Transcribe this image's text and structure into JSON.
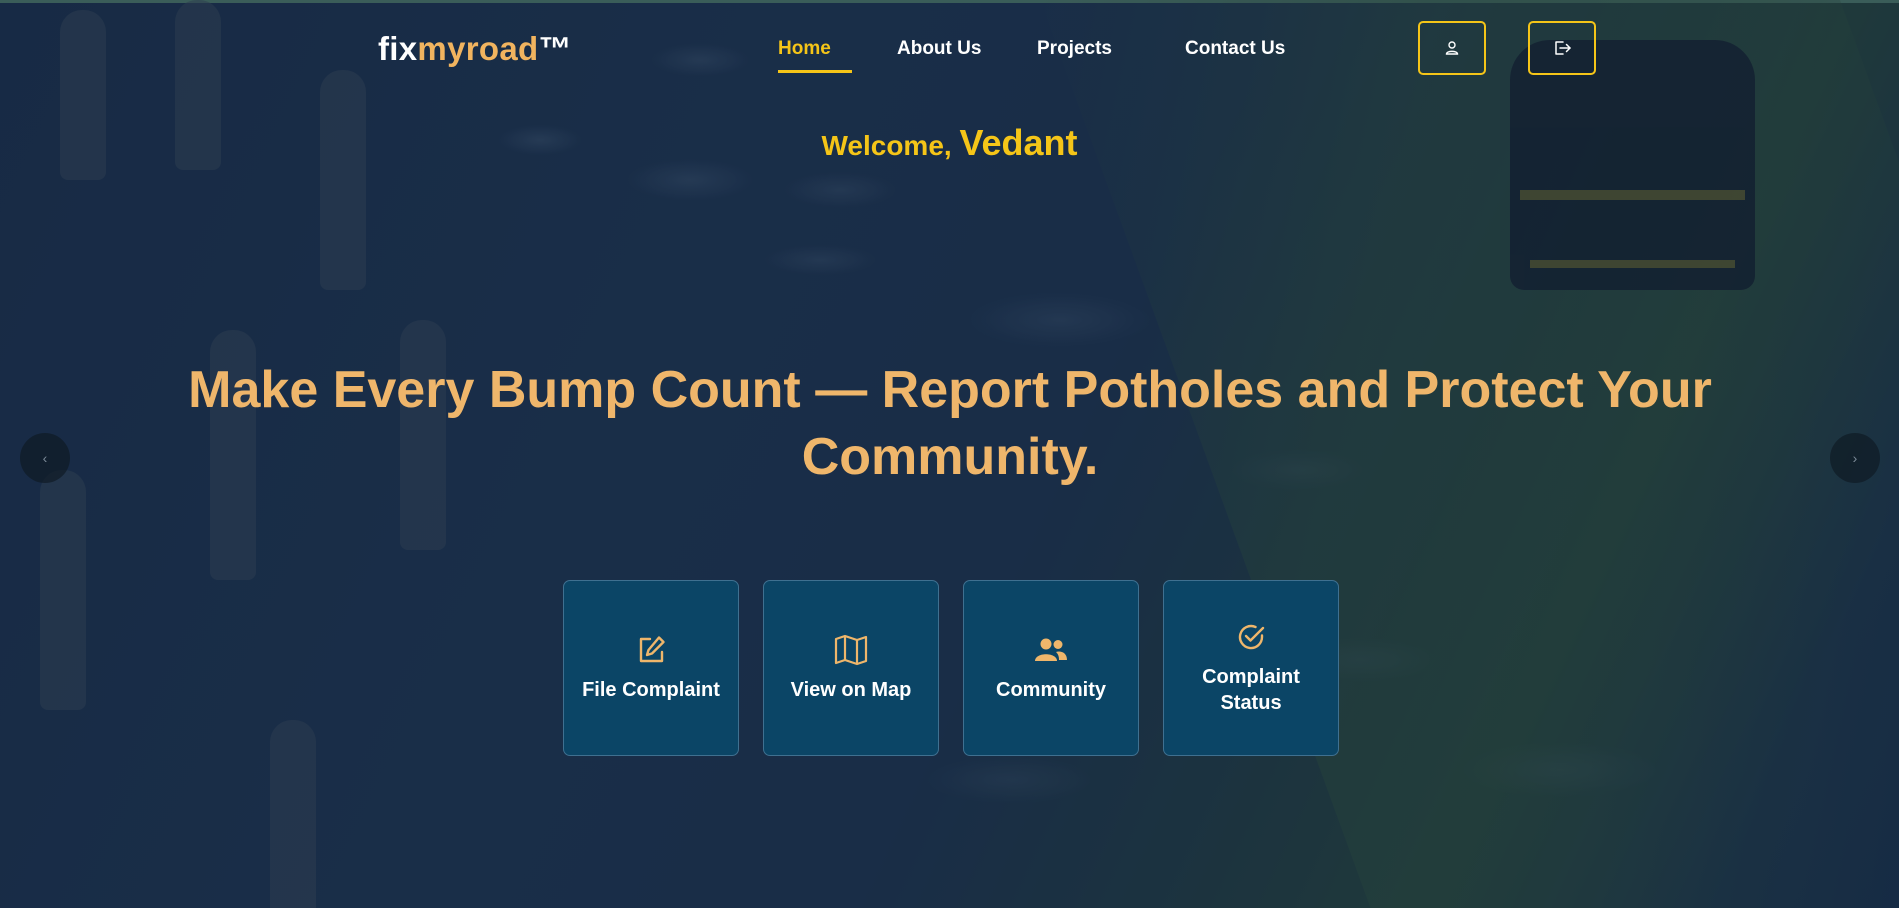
{
  "brand": {
    "logo_prefix": "fix",
    "logo_accent": "myroad",
    "logo_suffix": "™"
  },
  "nav": {
    "items": [
      {
        "label": "Home",
        "active": true
      },
      {
        "label": "About Us",
        "active": false
      },
      {
        "label": "Projects",
        "active": false
      },
      {
        "label": "Contact Us",
        "active": false
      }
    ],
    "profile_icon": "user-icon",
    "logout_icon": "logout-icon"
  },
  "welcome": {
    "greeting": "Welcome, ",
    "name": "Vedant"
  },
  "hero": {
    "headline": "Make Every Bump Count — Report Potholes and Protect Your Community."
  },
  "actions": [
    {
      "label": "File Complaint",
      "icon": "edit-icon"
    },
    {
      "label": "View on Map",
      "icon": "map-icon"
    },
    {
      "label": "Community",
      "icon": "users-icon"
    },
    {
      "label": "Complaint Status",
      "icon": "check-circle-icon"
    }
  ],
  "carousel": {
    "prev": "‹",
    "next": "›"
  },
  "colors": {
    "accent_yellow": "#f5c518",
    "headline_orange": "#efb66b",
    "card_bg": "#0b4566"
  }
}
